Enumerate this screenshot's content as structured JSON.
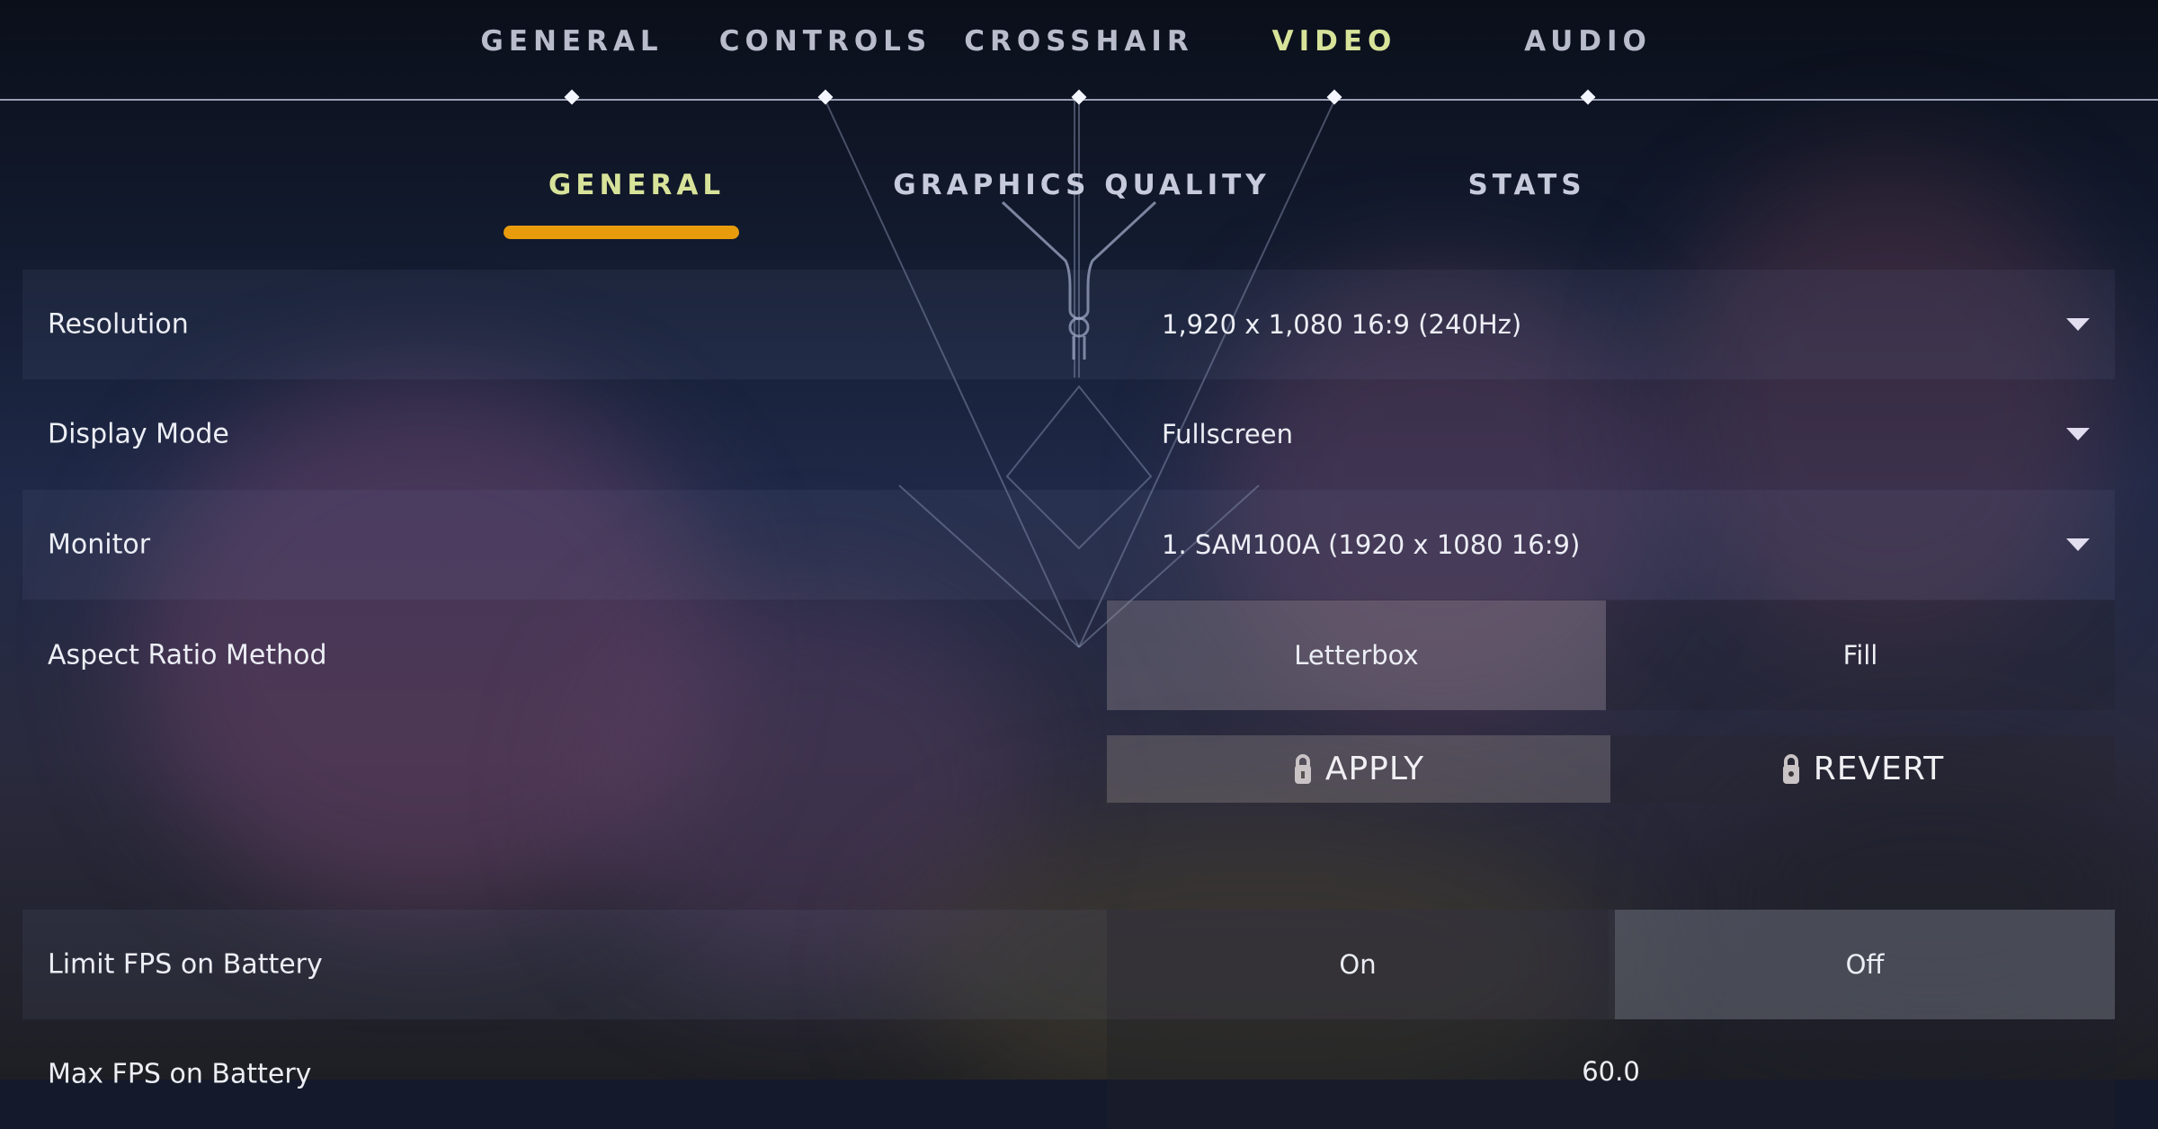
{
  "top_nav": {
    "tabs": [
      {
        "label": "GENERAL",
        "active": false
      },
      {
        "label": "CONTROLS",
        "active": false
      },
      {
        "label": "CROSSHAIR",
        "active": false
      },
      {
        "label": "VIDEO",
        "active": true
      },
      {
        "label": "AUDIO",
        "active": false
      }
    ]
  },
  "sub_nav": {
    "tabs": [
      {
        "label": "GENERAL",
        "active": true
      },
      {
        "label": "GRAPHICS QUALITY",
        "active": false
      },
      {
        "label": "STATS",
        "active": false
      }
    ]
  },
  "settings": {
    "resolution": {
      "label": "Resolution",
      "value": "1,920 x 1,080 16:9 (240Hz)",
      "icon": "chevron-down-icon"
    },
    "display_mode": {
      "label": "Display Mode",
      "value": "Fullscreen",
      "icon": "chevron-down-icon"
    },
    "monitor": {
      "label": "Monitor",
      "value": "1. SAM100A (1920 x  1080 16:9)",
      "icon": "chevron-down-icon"
    },
    "aspect_ratio": {
      "label": "Aspect Ratio Method",
      "options": [
        "Letterbox",
        "Fill"
      ],
      "selected": "Letterbox"
    },
    "limit_fps_battery": {
      "label": "Limit FPS on Battery",
      "options": [
        "On",
        "Off"
      ],
      "selected": "Off"
    },
    "max_fps_battery": {
      "label": "Max FPS on Battery",
      "value": "60.0"
    }
  },
  "actions": {
    "apply_label": "APPLY",
    "revert_label": "REVERT",
    "icon": "lock-icon"
  },
  "colors": {
    "active_tab": "#d8e39a",
    "accent_underline": "#e89c0c",
    "inactive_tab": "#b9bccb"
  }
}
